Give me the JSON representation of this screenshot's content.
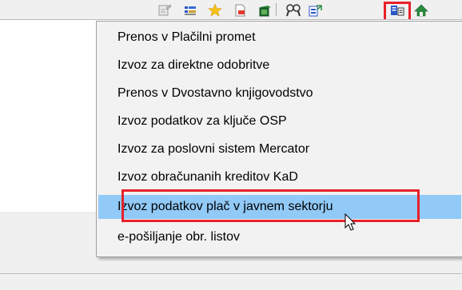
{
  "toolbar": {
    "icons": [
      "report-icon",
      "list-icon",
      "star-icon",
      "document-icon",
      "window-icon",
      "search-people-icon",
      "export-icon",
      "transfer-icon",
      "home-icon"
    ],
    "highlighted_icon": "transfer-icon"
  },
  "menu": {
    "items": [
      {
        "label": "Prenos v Plačilni promet"
      },
      {
        "label": "Izvoz za direktne odobritve"
      },
      {
        "label": "Prenos v Dvostavno knjigovodstvo"
      },
      {
        "label": "Izvoz podatkov za ključe OSP"
      },
      {
        "label": "Izvoz za poslovni sistem Mercator"
      },
      {
        "label": "Izvoz obračunanih kreditov KaD"
      },
      {
        "label": "Izvoz podatkov plač v javnem sektorju"
      },
      {
        "label": "e-pošiljanje obr. listov"
      }
    ],
    "highlighted_index": 6
  },
  "colors": {
    "highlight": "#91c9f7",
    "annotation_red": "#e8202a",
    "menu_bg": "#f2f2f2"
  }
}
